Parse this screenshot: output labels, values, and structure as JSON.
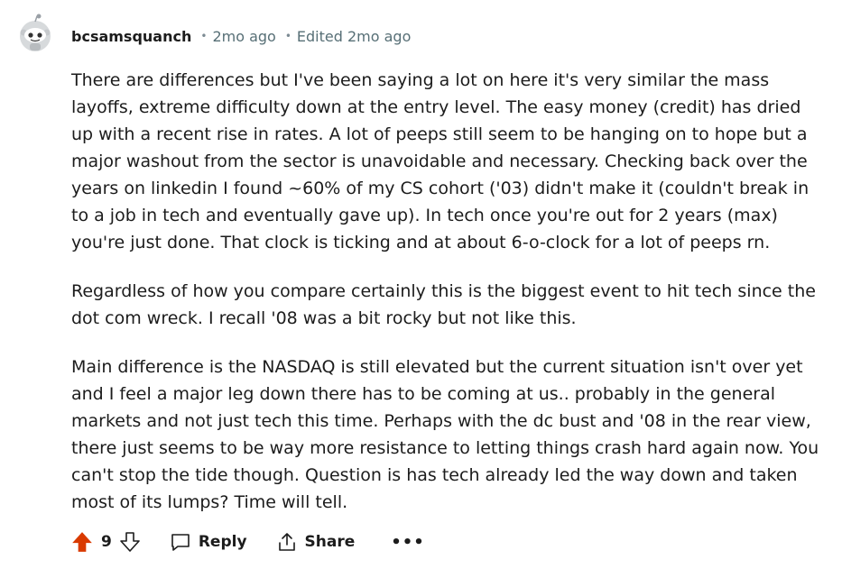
{
  "comment": {
    "author": "bcsamsquanch",
    "time": "2mo ago",
    "edited": "Edited 2mo ago",
    "paragraphs": [
      "There are differences but I've been saying a lot on here it's very similar the mass layoffs, extreme difficulty down at the entry level. The easy money (credit) has dried up with a recent rise in rates. A lot of peeps still seem to be hanging on to hope but a major washout from the sector is unavoidable and necessary. Checking back over the years on linkedin I found ~60% of my CS cohort ('03) didn't make it (couldn't break in to a job in tech and eventually gave up). In tech once you're out for 2 years (max) you're just done. That clock is ticking and at about 6-o-clock for a lot of peeps rn.",
      "Regardless of how you compare certainly this is the biggest event to hit tech since the dot com wreck. I recall '08 was a bit rocky but not like this.",
      "Main difference is the NASDAQ is still elevated but the current situation isn't over yet and I feel a major leg down there has to be coming at us.. probably in the general markets and not just tech this time. Perhaps with the dc bust and '08 in the rear view, there just seems to be way more resistance to letting things crash hard again now. You can't stop the tide though. Question is has tech already led the way down and taken most of its lumps? Time will tell."
    ]
  },
  "actions": {
    "score": "9",
    "reply_label": "Reply",
    "share_label": "Share",
    "more_label": "•••",
    "upvote_color": "#d93a00"
  },
  "icons": {
    "avatar": "snoo-avatar-icon",
    "upvote": "upvote-arrow-icon",
    "downvote": "downvote-arrow-icon",
    "reply": "speech-bubble-icon",
    "share": "share-icon",
    "more": "ellipsis-icon"
  }
}
